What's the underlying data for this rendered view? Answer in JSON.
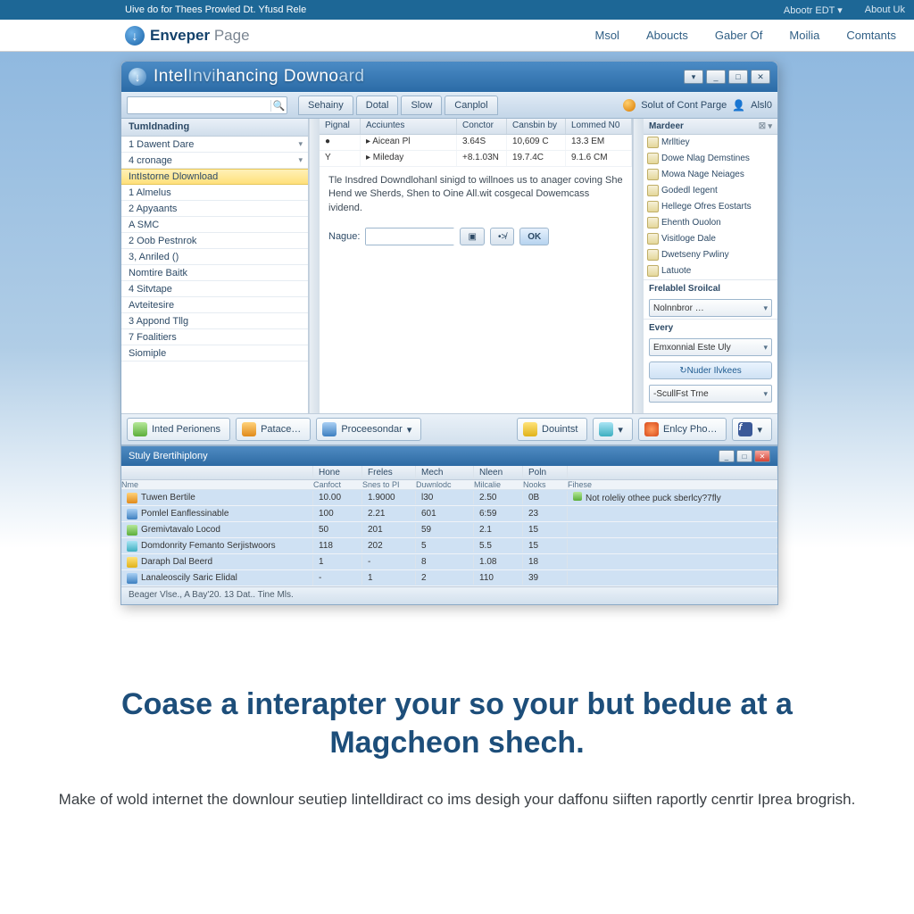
{
  "topbar": {
    "tagline": "Uive do for Thees Prowled Dt. Yfusd Rele",
    "links": [
      "Abootr EDT ▾",
      "About Uk"
    ]
  },
  "site": {
    "brand_bold": "Enveper",
    "brand_light": " Page",
    "nav": [
      "Msol",
      "Aboucts",
      "Gaber Of",
      "Moilia",
      "Comtants"
    ]
  },
  "app": {
    "title_parts": [
      "Intel",
      "Invi",
      "hancing ",
      "Downo",
      "ard"
    ],
    "win": [
      "▾",
      "_",
      "□",
      "✕"
    ],
    "tabs": [
      "Sehainy",
      "Dotal",
      "Slow",
      "Canplol"
    ],
    "sol_label": "Solut of Cont Parge",
    "user": "Alsl0",
    "sidebar": {
      "title": "Tumldnading",
      "items": [
        {
          "t": "1  Dawent Dare",
          "exp": true
        },
        {
          "t": "4 cronage",
          "exp": true
        },
        {
          "t": "IntIstorne Dlownload",
          "sel": true
        },
        {
          "t": "1 Almelus"
        },
        {
          "t": "2 Apyaants"
        },
        {
          "t": "A SMC"
        },
        {
          "t": "2 Oob Pestnrok"
        },
        {
          "t": "3, Anriled ()"
        },
        {
          "t": "Nomtire Baitk"
        },
        {
          "t": "4 Sitvtape"
        },
        {
          "t": "Avteitesire"
        },
        {
          "t": "3 Appond Tllg"
        },
        {
          "t": "7 Foalitiers"
        },
        {
          "t": "Siomiple"
        }
      ]
    },
    "grid": {
      "cols": [
        "Pignal",
        "Acciuntes",
        "Conctor",
        "Cansbin by",
        "Lommed N0"
      ],
      "rows": [
        [
          "●",
          "▸ Aicean Pl",
          "3.64S",
          "10,609 C",
          "13.3 EM"
        ],
        [
          "Y",
          "▸ Mileday",
          "+8.1.03N",
          "19.7.4C",
          "9.1.6 CM"
        ]
      ]
    },
    "desc": "Tle Insdred Downdlohanl sinigd to willnoes us to anager coving She Hend we Sherds, Shen to Oine All.wit cosgecal Dowemcass ividend.",
    "form": {
      "label": "Nague:",
      "btn1": "▣",
      "btn2": "•≯",
      "ok": "OK"
    },
    "right": {
      "title": "Mardeer",
      "items": [
        "Mrlltiey",
        "Dowe Nlag Demstines",
        "Mowa Nage Neiages",
        "Godedl Iegent",
        "Hellege Ofres Eostarts",
        "Ehenth Ouolon",
        "Visitloge Dale",
        "Dwetseny Pwliny",
        "Latuote"
      ],
      "sec1": "Frelablel Sroilcal",
      "sel1": "Nolnnbror …",
      "sec2": "Every",
      "sel2": "Emxonnial Este Uly",
      "link": "Nuder Ilvkees",
      "sel3": "-ScullFst Trne"
    },
    "btnbar": [
      "Inted Perionens",
      "Patace…",
      "Proceesondar",
      "",
      "Douintst",
      "",
      "Enlcy Pho…",
      ""
    ],
    "panel2": {
      "title": "Stuly Brertihiplony",
      "heads": [
        "Hone",
        "Freles",
        "Mech",
        "Nleen",
        "Poln",
        ""
      ],
      "sub": [
        "Nme",
        "Canfoct",
        "Snes to PI",
        "Duwnlodc",
        "Milcalie",
        "Nooks",
        "Fihese"
      ],
      "rows": [
        {
          "ic": "ic-o",
          "n": "Tuwen Bertile",
          "v": [
            "10.00",
            "1.9000",
            "l30",
            "2.50",
            "0B"
          ],
          "note": "Not roleliy othee puck sberlcy?7fly"
        },
        {
          "ic": "ic-b",
          "n": "Pomlel Eanflessinable",
          "v": [
            "100",
            "2.21",
            "601",
            "6:59",
            "23"
          ]
        },
        {
          "ic": "ic-g",
          "n": "Gremivtavalo Locod",
          "v": [
            "50",
            "201",
            "59",
            "2.1",
            "15"
          ]
        },
        {
          "ic": "ic-t",
          "n": "Domdonrity Femanto Serjistwoors",
          "v": [
            "118",
            "202",
            "5",
            "5.5",
            "15"
          ]
        },
        {
          "ic": "ic-y",
          "n": "Daraph Dal Beerd",
          "v": [
            "1",
            "-",
            "8",
            "1.08",
            "18"
          ]
        },
        {
          "ic": "ic-b",
          "n": "Lanaleoscily Saric Elidal",
          "v": [
            "-",
            "1",
            "2",
            "110",
            "39"
          ]
        }
      ]
    },
    "status": "Beager Vlse., A Bay'20. 13 Dat.. Tine Mls."
  },
  "hero": {
    "h": "Coase a interapter your so your but bedue at a Magcheon shech.",
    "p": "Make of wold internet the downlour seutiep lintelldiract co ims desigh your daffonu siiften raportly cenrtir Iprea brogrish."
  }
}
